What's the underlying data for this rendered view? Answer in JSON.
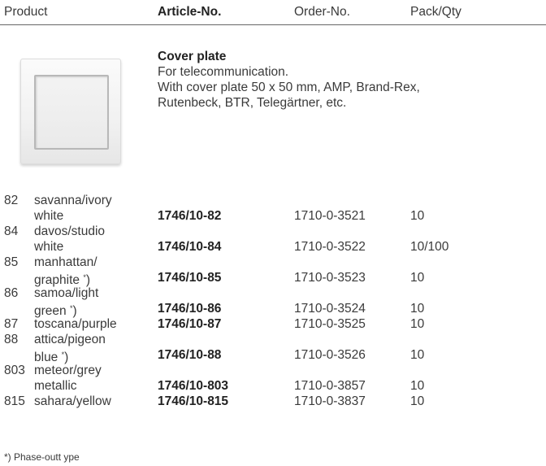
{
  "header": {
    "product": "Product",
    "article_no": "Article-No.",
    "order_no": "Order-No.",
    "pack_qty": "Pack/Qty"
  },
  "item": {
    "title": "Cover plate",
    "lines": [
      "For telecommunication.",
      "With cover plate 50 x 50 mm, AMP, Brand-Rex,",
      "Rutenbeck, BTR, Telegärtner, etc."
    ]
  },
  "rows": [
    {
      "code": "82",
      "name_line1": "savanna/ivory",
      "name_line2": "white",
      "sup": "",
      "article": "1746/10-82",
      "order": "1710-0-3521",
      "pack": "10"
    },
    {
      "code": "84",
      "name_line1": "davos/studio",
      "name_line2": "white",
      "sup": "",
      "article": "1746/10-84",
      "order": "1710-0-3522",
      "pack": "10/100"
    },
    {
      "code": "85",
      "name_line1": "manhattan/",
      "name_line2": "graphite ",
      "sup": "*",
      "tail": ")",
      "article": "1746/10-85",
      "order": "1710-0-3523",
      "pack": "10"
    },
    {
      "code": "86",
      "name_line1": "samoa/light",
      "name_line2": "green ",
      "sup": "*",
      "tail": ")",
      "article": "1746/10-86",
      "order": "1710-0-3524",
      "pack": "10"
    },
    {
      "code": "87",
      "name_line1": "toscana/purple",
      "name_line2": "",
      "sup": "",
      "article": "1746/10-87",
      "order": "1710-0-3525",
      "pack": "10"
    },
    {
      "code": "88",
      "name_line1": "attica/pigeon",
      "name_line2": "blue ",
      "sup": "*",
      "tail": ")",
      "article": "1746/10-88",
      "order": "1710-0-3526",
      "pack": "10"
    },
    {
      "code": "803",
      "name_line1": "meteor/grey",
      "name_line2": "metallic",
      "sup": "",
      "article": "1746/10-803",
      "order": "1710-0-3857",
      "pack": "10"
    },
    {
      "code": "815",
      "name_line1": "sahara/yellow",
      "name_line2": "",
      "sup": "",
      "article": "1746/10-815",
      "order": "1710-0-3837",
      "pack": "10"
    }
  ],
  "footnote": "*)  Phase-outt ype"
}
